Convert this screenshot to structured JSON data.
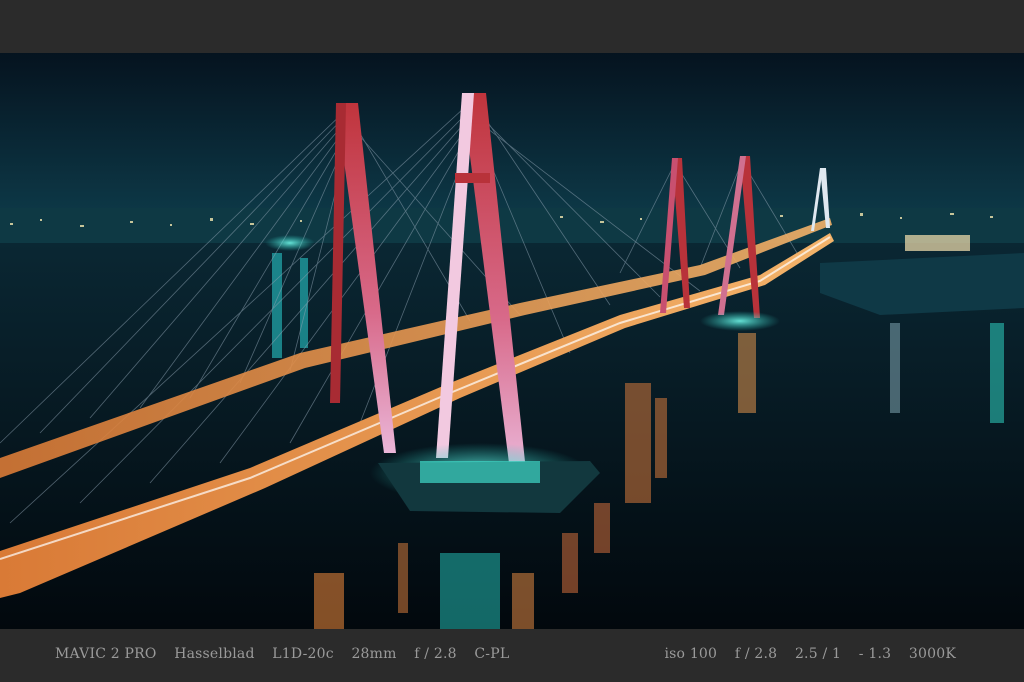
{
  "caption": {
    "left": [
      "MAVIC 2 PRO",
      "Hasselblad",
      "L1D-20c",
      "28mm",
      "f / 2.8",
      "C-PL"
    ],
    "right": [
      "iso 100",
      "f / 2.8",
      "2.5 / 1",
      "- 1.3",
      "3000K"
    ]
  },
  "colors": {
    "frame": "#2b2b2b",
    "sky_top": "#061a2a",
    "sky_horizon": "#0d3a4a",
    "water": "#031019",
    "tower": "#b8323a",
    "deck_light": "#e98a3c",
    "accent_cyan": "#3fe3d4"
  }
}
